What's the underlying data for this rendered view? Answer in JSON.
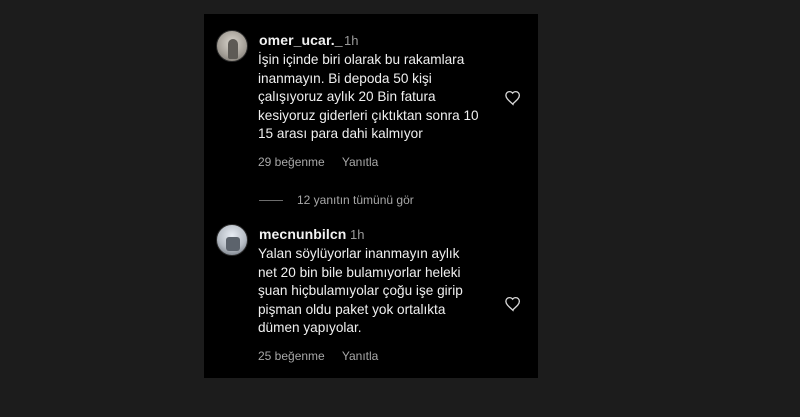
{
  "comments": [
    {
      "username": "omer_ucar._",
      "time": "1h",
      "text": "İşin içinde biri olarak bu rakamlara\ninanmayın. Bi depoda 50 kişi\nçalışıyoruz aylık 20 Bin fatura\nkesiyoruz giderleri çıktıktan sonra 10\n15 arası para dahi kalmıyor",
      "likes": "29 beğenme",
      "reply": "Yanıtla"
    },
    {
      "username": "mecnunbilcn",
      "time": "1h",
      "text": "Yalan söylüyorlar inanmayın aylık\nnet 20 bin bile bulamıyorlar heleki\nşuan hiçbulamıyolar çoğu işe girip\npişman oldu paket yok ortalıkta\ndümen yapıyolar.",
      "likes": "25 beğenme",
      "reply": "Yanıtla"
    }
  ],
  "view_replies": "12 yanıtın tümünü gör",
  "icons": {
    "like": "heart-outline-icon",
    "avatar": "avatar"
  },
  "colors": {
    "background": "#000000",
    "outer": "#1c1c1c",
    "text": "#f0f0f0",
    "muted": "#a8a8a8"
  }
}
